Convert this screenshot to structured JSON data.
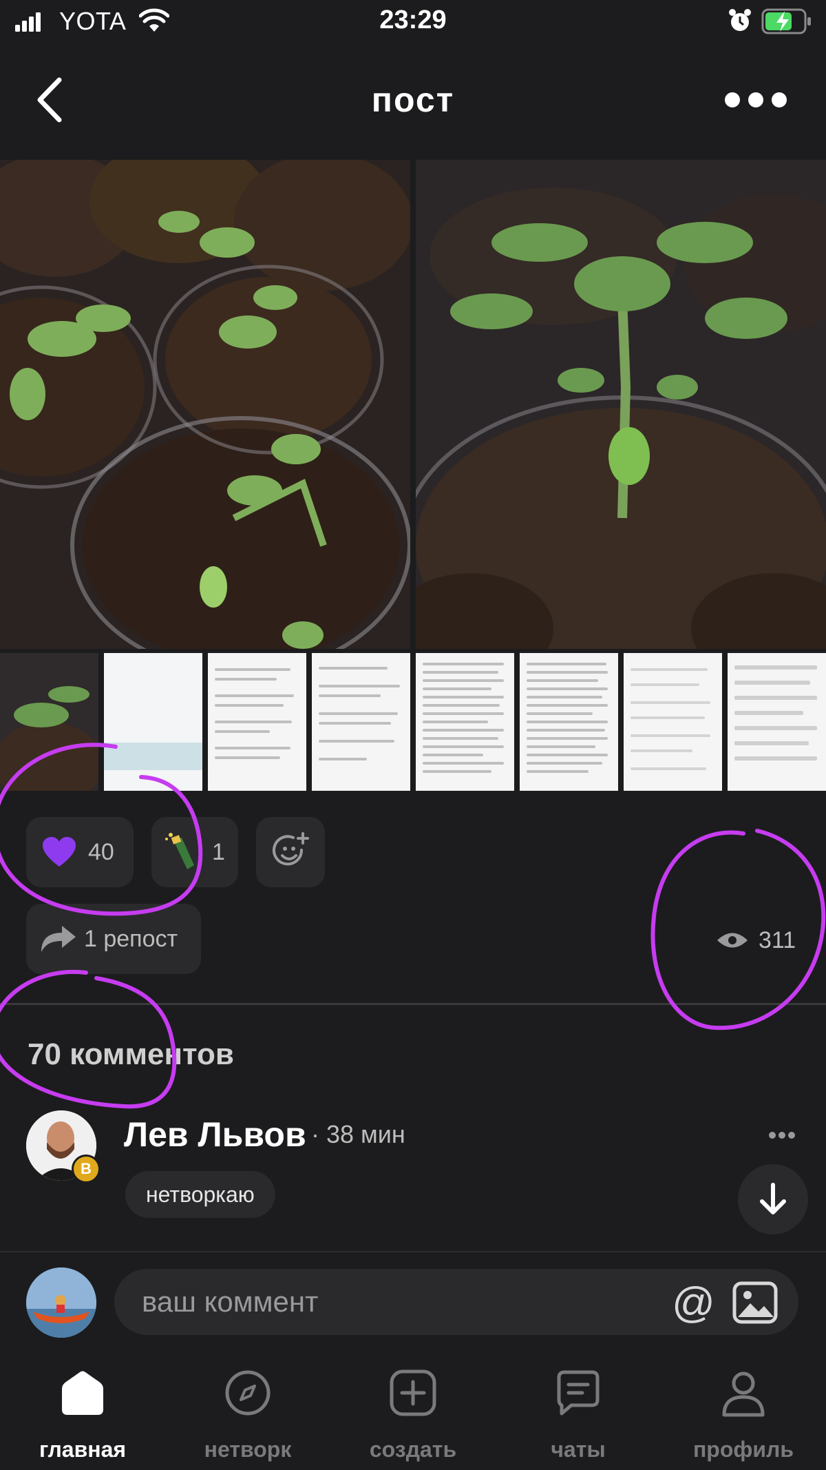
{
  "status_bar": {
    "carrier": "YOTA",
    "time": "23:29"
  },
  "header": {
    "title": "пост"
  },
  "reactions": [
    {
      "icon": "purple-heart-icon",
      "count": "40"
    },
    {
      "icon": "champagne-icon",
      "count": "1"
    }
  ],
  "repost": {
    "label": "1 репост"
  },
  "views": {
    "count": "311"
  },
  "comments": {
    "title": "70 комментов",
    "first": {
      "author": "Лев Львов",
      "time": "· 38 мин",
      "badge": "В",
      "tag": "нетворкаю"
    }
  },
  "comment_input": {
    "placeholder": "ваш коммент",
    "at_symbol": "@"
  },
  "tabs": [
    {
      "label": "главная",
      "icon": "home-icon",
      "active": true
    },
    {
      "label": "нетворк",
      "icon": "compass-icon",
      "active": false
    },
    {
      "label": "создать",
      "icon": "plus-square-icon",
      "active": false
    },
    {
      "label": "чаты",
      "icon": "chat-icon",
      "active": false
    },
    {
      "label": "профиль",
      "icon": "profile-icon",
      "active": false
    }
  ],
  "colors": {
    "background": "#1c1c1e",
    "chip": "#2a2a2c",
    "annotation": "#c63cf0",
    "heart": "#8e3bf0",
    "battery": "#4cd964"
  }
}
